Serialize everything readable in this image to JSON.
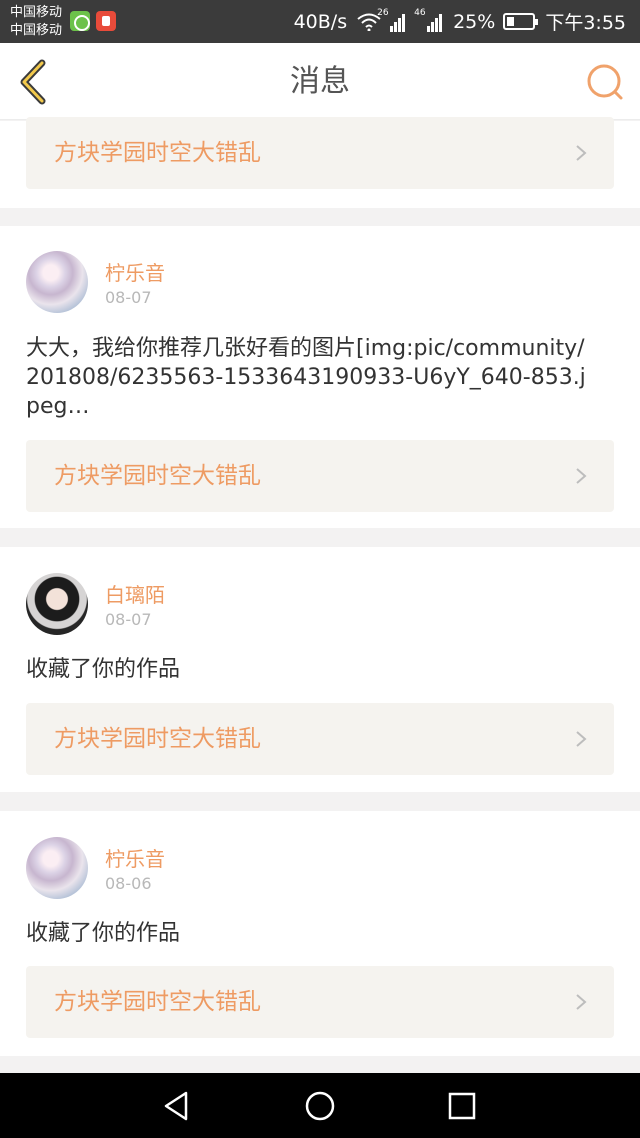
{
  "status_bar": {
    "carrier_1": "中国移动",
    "carrier_2": "中国移动",
    "net_speed": "40B/s",
    "sim1_tag": "26",
    "sim2_tag": "46",
    "battery": "25%",
    "time": "下午3:55"
  },
  "header": {
    "title": "消息",
    "accent_color": "#f0a26b"
  },
  "messages": [
    {
      "work_title": "方块学园时空大错乱"
    },
    {
      "user": "柠乐音",
      "date": "08-07",
      "text": "大大，我给你推荐几张好看的图片[img:pic/community/201808/6235563-1533643190933-U6yY_640-853.jpeg…",
      "work_title": "方块学园时空大错乱"
    },
    {
      "user": "白璃陌",
      "date": "08-07",
      "text": "收藏了你的作品",
      "work_title": "方块学园时空大错乱"
    },
    {
      "user": "柠乐音",
      "date": "08-06",
      "text": "收藏了你的作品",
      "work_title": "方块学园时空大错乱"
    }
  ],
  "icons": {
    "back": "chevron-left-icon",
    "search": "search-icon",
    "nav_back": "triangle-back-icon",
    "nav_home": "circle-home-icon",
    "nav_recent": "square-recents-icon"
  }
}
